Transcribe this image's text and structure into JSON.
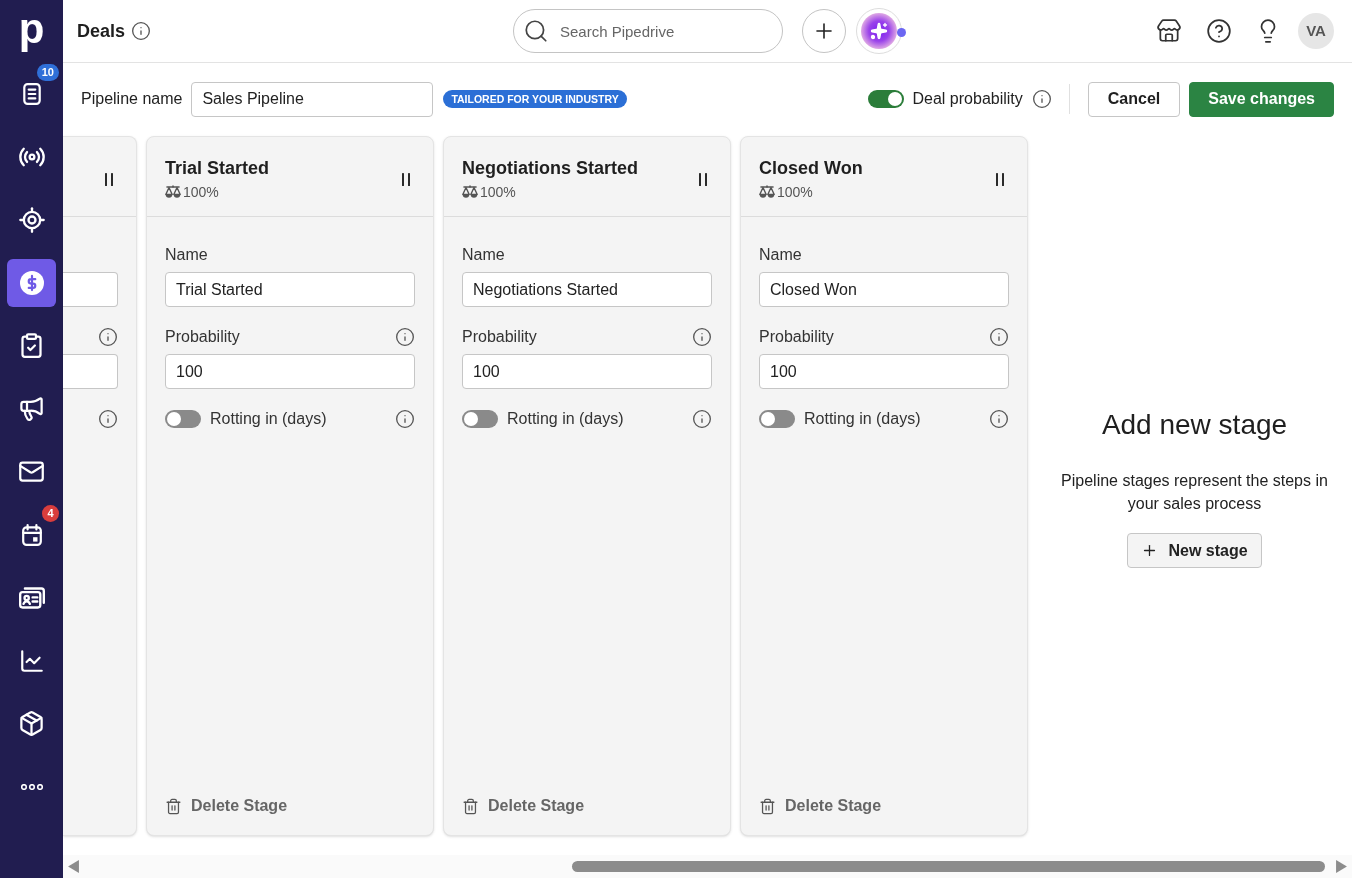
{
  "sidebar": {
    "logo": "p",
    "items": [
      {
        "selected": false,
        "badge": {
          "text": "10",
          "color": "#2f6fd8"
        }
      },
      {
        "selected": false
      },
      {
        "selected": false
      },
      {
        "selected": true
      },
      {
        "selected": false
      },
      {
        "selected": false
      },
      {
        "selected": false
      },
      {
        "selected": false,
        "badge": {
          "text": "4",
          "color": "#d93d3d"
        }
      },
      {
        "selected": false
      },
      {
        "selected": false
      },
      {
        "selected": false
      },
      {
        "selected": false
      }
    ]
  },
  "header": {
    "title": "Deals",
    "search": {
      "placeholder": "Search Pipedrive"
    },
    "assistant": {
      "notification": true
    },
    "avatar": "VA"
  },
  "toolbar": {
    "pipeline_name": {
      "label": "Pipeline name",
      "value": "Sales Pipeline"
    },
    "badge": "TAILORED FOR YOUR INDUSTRY",
    "deal_probability": {
      "label": "Deal probability",
      "on": true
    },
    "buttons": [
      {
        "label": "Cancel",
        "kind": "secondary"
      },
      {
        "label": "Save changes",
        "kind": "primary"
      }
    ]
  },
  "stages": [
    {
      "kind": "clipped"
    },
    {
      "kind": "full",
      "title": "Trial Started",
      "probability": "100%",
      "fields": [
        {
          "label": "Name",
          "value": "Trial Started",
          "info": false
        },
        {
          "label": "Probability",
          "value": "100",
          "info": true
        }
      ],
      "rotting": {
        "label": "Rotting in (days)",
        "on": false
      },
      "delete": "Delete Stage"
    },
    {
      "kind": "full",
      "title": "Negotiations Started",
      "probability": "100%",
      "fields": [
        {
          "label": "Name",
          "value": "Negotiations Started",
          "info": false
        },
        {
          "label": "Probability",
          "value": "100",
          "info": true
        }
      ],
      "rotting": {
        "label": "Rotting in (days)",
        "on": false
      },
      "delete": "Delete Stage"
    },
    {
      "kind": "full",
      "title": "Closed Won",
      "probability": "100%",
      "fields": [
        {
          "label": "Name",
          "value": "Closed Won",
          "info": false
        },
        {
          "label": "Probability",
          "value": "100",
          "info": true
        }
      ],
      "rotting": {
        "label": "Rotting in (days)",
        "on": false
      },
      "delete": "Delete Stage"
    }
  ],
  "add_stage": {
    "title": "Add new stage",
    "description": "Pipeline stages represent the steps in your sales process",
    "button": "New stage"
  }
}
